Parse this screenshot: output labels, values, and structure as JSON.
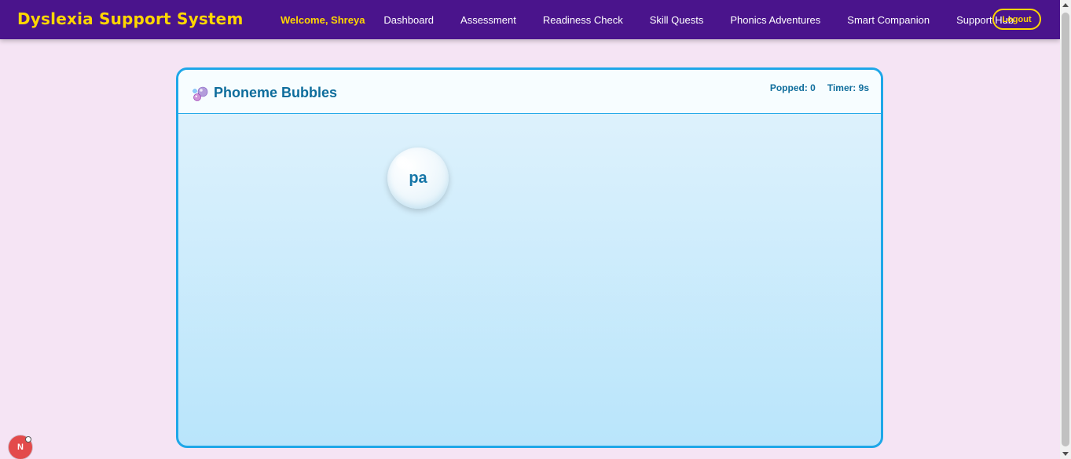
{
  "brand": "Dyslexia Support System",
  "nav": {
    "welcome": "Welcome, Shreya",
    "links": [
      "Dashboard",
      "Assessment",
      "Readiness Check",
      "Skill Quests",
      "Phonics Adventures",
      "Smart Companion",
      "Support Hub"
    ],
    "logout": "Logout"
  },
  "game": {
    "title": "Phoneme Bubbles",
    "popped_label": "Popped: ",
    "popped_value": "0",
    "timer_label": "Timer: ",
    "timer_value": "9s",
    "bubbles": [
      {
        "text": "pa"
      }
    ]
  },
  "dev_badge": "N",
  "colors": {
    "navbar": "#4a148c",
    "brand": "#ffd600",
    "background": "#f5e4f4",
    "game_border": "#1ea7e8",
    "title": "#0e6d9c"
  }
}
